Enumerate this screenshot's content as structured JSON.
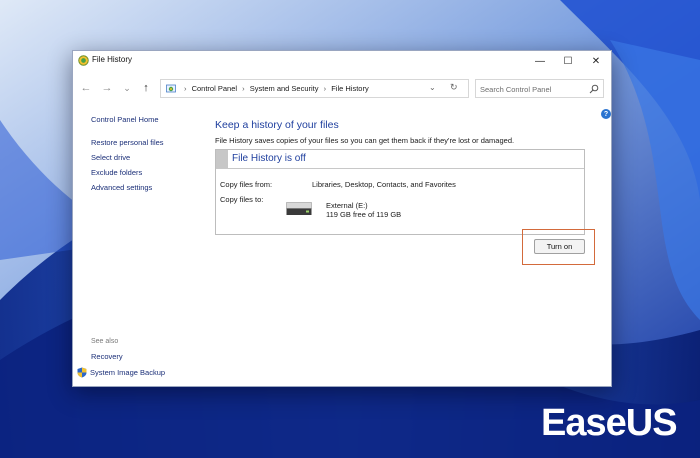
{
  "window": {
    "title": "File History",
    "controls": {
      "minimize": "—",
      "maximize": "☐",
      "close": "✕"
    }
  },
  "nav": {
    "back": "←",
    "forward": "→",
    "recent": "⌄",
    "up": "↑",
    "breadcrumbs": [
      "Control Panel",
      "System and Security",
      "File History"
    ],
    "breadcrumb_sep": "›",
    "refresh": "↻",
    "dropdown": "⌄"
  },
  "search": {
    "placeholder": "Search Control Panel"
  },
  "help": {
    "glyph": "?"
  },
  "sidebar": {
    "home": "Control Panel Home",
    "items": [
      {
        "label": "Restore personal files"
      },
      {
        "label": "Select drive"
      },
      {
        "label": "Exclude folders"
      },
      {
        "label": "Advanced settings"
      }
    ],
    "see_also": "See also",
    "recovery": "Recovery",
    "system_image_backup": "System Image Backup"
  },
  "main": {
    "heading": "Keep a history of your files",
    "description": "File History saves copies of your files so you can get them back if they're lost or damaged.",
    "status": {
      "title": "File History is off",
      "copy_from_label": "Copy files from:",
      "copy_from_value": "Libraries, Desktop, Contacts, and Favorites",
      "copy_to_label": "Copy files to:",
      "drive_name": "External (E:)",
      "drive_space": "119 GB free of 119 GB"
    },
    "turn_on_label": "Turn on"
  },
  "watermark": {
    "text": "EaseUS"
  },
  "colors": {
    "accent_blue": "#1f3f9e",
    "link_blue": "#1b2f78",
    "highlight": "#d36a3b",
    "wallpaper": "#1a3fa0"
  }
}
